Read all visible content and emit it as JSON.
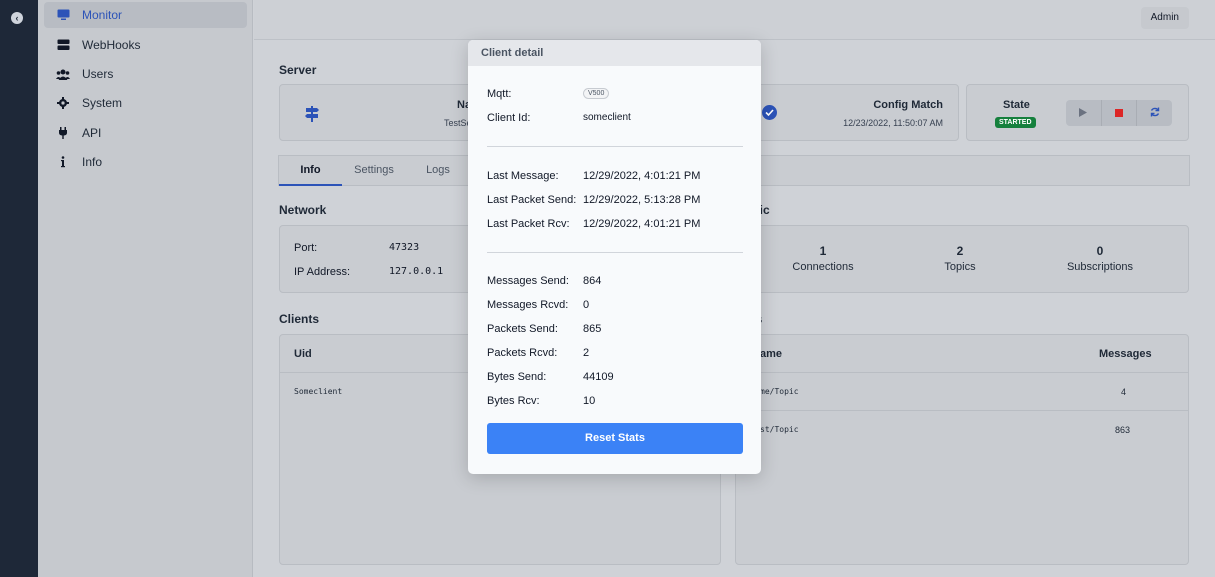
{
  "sidebar": {
    "items": [
      {
        "label": "Monitor",
        "icon": "monitor-icon"
      },
      {
        "label": "WebHooks",
        "icon": "server-icon"
      },
      {
        "label": "Users",
        "icon": "users-icon"
      },
      {
        "label": "System",
        "icon": "gear-icon"
      },
      {
        "label": "API",
        "icon": "plug-icon"
      },
      {
        "label": "Info",
        "icon": "info-icon"
      }
    ]
  },
  "header": {
    "user": "Admin"
  },
  "server": {
    "title": "Server",
    "name_label": "Na",
    "name_value": "TestSe",
    "config_label": "Config Match",
    "config_time": "12/23/2022, 11:50:07 AM",
    "state_label": "State",
    "state_value": "STARTED"
  },
  "tabs": [
    "Info",
    "Settings",
    "Logs"
  ],
  "network": {
    "title": "Network",
    "port_label": "Port:",
    "port_value": "47323",
    "ip_label": "IP Address:",
    "ip_value": "127.0.0.1"
  },
  "statistic": {
    "title": "stic",
    "items": [
      {
        "value": "1",
        "label": "Connections"
      },
      {
        "value": "2",
        "label": "Topics"
      },
      {
        "value": "0",
        "label": "Subscriptions"
      }
    ]
  },
  "clients": {
    "title": "Clients",
    "header": "Uid",
    "rows": [
      "Someclient"
    ]
  },
  "topics": {
    "title": "cs",
    "headers": [
      "ame",
      "Messages"
    ],
    "rows": [
      {
        "name": "me/Topic",
        "messages": "4"
      },
      {
        "name": "st/Topic",
        "messages": "863"
      }
    ]
  },
  "modal": {
    "title": "Client detail",
    "mqtt_label": "Mqtt:",
    "mqtt_value": "V500",
    "client_id_label": "Client Id:",
    "client_id_value": "someclient",
    "last_message_label": "Last Message:",
    "last_message_value": "12/29/2022, 4:01:21 PM",
    "last_packet_send_label": "Last Packet Send:",
    "last_packet_send_value": "12/29/2022, 5:13:28 PM",
    "last_packet_rcv_label": "Last Packet Rcv:",
    "last_packet_rcv_value": "12/29/2022, 4:01:21 PM",
    "messages_send_label": "Messages Send:",
    "messages_send_value": "864",
    "messages_rcvd_label": "Messages Rcvd:",
    "messages_rcvd_value": "0",
    "packets_send_label": "Packets Send:",
    "packets_send_value": "865",
    "packets_rcvd_label": "Packets Rcvd:",
    "packets_rcvd_value": "2",
    "bytes_send_label": "Bytes Send:",
    "bytes_send_value": "44109",
    "bytes_rcv_label": "Bytes Rcv:",
    "bytes_rcv_value": "10",
    "reset_label": "Reset Stats"
  },
  "colors": {
    "rail": "#1e2838",
    "accent": "#2c53b8",
    "button": "#3b82f6",
    "started": "#15803d",
    "stop": "#dc2626"
  }
}
